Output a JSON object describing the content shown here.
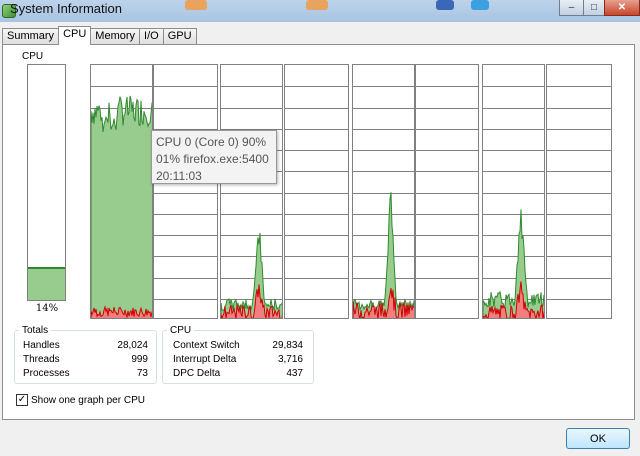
{
  "window": {
    "title": "System Information"
  },
  "tabs": [
    {
      "label": "Summary",
      "active": false
    },
    {
      "label": "CPU",
      "active": true
    },
    {
      "label": "Memory",
      "active": false
    },
    {
      "label": "I/O",
      "active": false
    },
    {
      "label": "GPU",
      "active": false
    }
  ],
  "cpu": {
    "label": "CPU",
    "usage_percent": 14,
    "usage_text": "14%"
  },
  "tooltip": {
    "line1": "CPU 0 (Core 0) 90%",
    "line2": "01% firefox.exe:5400",
    "line3": "20:11:03"
  },
  "graphs": [
    {
      "name": "core-0",
      "level": 0.82,
      "peak": 0.88,
      "kernel": 0.04,
      "shape": "high"
    },
    {
      "name": "core-1",
      "level": 0.0,
      "peak": 0.0,
      "kernel": 0.0,
      "shape": "flat"
    },
    {
      "name": "core-2",
      "level": 0.06,
      "peak": 0.35,
      "kernel": 0.05,
      "shape": "spike"
    },
    {
      "name": "core-3",
      "level": 0.0,
      "peak": 0.0,
      "kernel": 0.0,
      "shape": "flat"
    },
    {
      "name": "core-4",
      "level": 0.06,
      "peak": 0.5,
      "kernel": 0.06,
      "shape": "spike"
    },
    {
      "name": "core-5",
      "level": 0.0,
      "peak": 0.0,
      "kernel": 0.0,
      "shape": "flat"
    },
    {
      "name": "core-6",
      "level": 0.08,
      "peak": 0.43,
      "kernel": 0.05,
      "shape": "spike"
    },
    {
      "name": "core-7",
      "level": 0.0,
      "peak": 0.0,
      "kernel": 0.0,
      "shape": "flat"
    }
  ],
  "totals": {
    "title": "Totals",
    "rows": [
      {
        "label": "Handles",
        "value": "28,024"
      },
      {
        "label": "Threads",
        "value": "999"
      },
      {
        "label": "Processes",
        "value": "73"
      }
    ]
  },
  "cpu_group": {
    "title": "CPU",
    "rows": [
      {
        "label": "Context Switch",
        "value": "29,834"
      },
      {
        "label": "Interrupt Delta",
        "value": "3,716"
      },
      {
        "label": "DPC Delta",
        "value": "437"
      }
    ]
  },
  "options": {
    "one_graph_per_cpu": "Show one graph per CPU",
    "checked": true,
    "check_mark": "✓"
  },
  "footer": {
    "ok_label": "OK"
  },
  "colors": {
    "user_fill": "#98cc8f",
    "user_line": "#2f8a2f",
    "kernel_fill": "#f08080",
    "kernel_line": "#d00000",
    "grid": "#808080"
  }
}
